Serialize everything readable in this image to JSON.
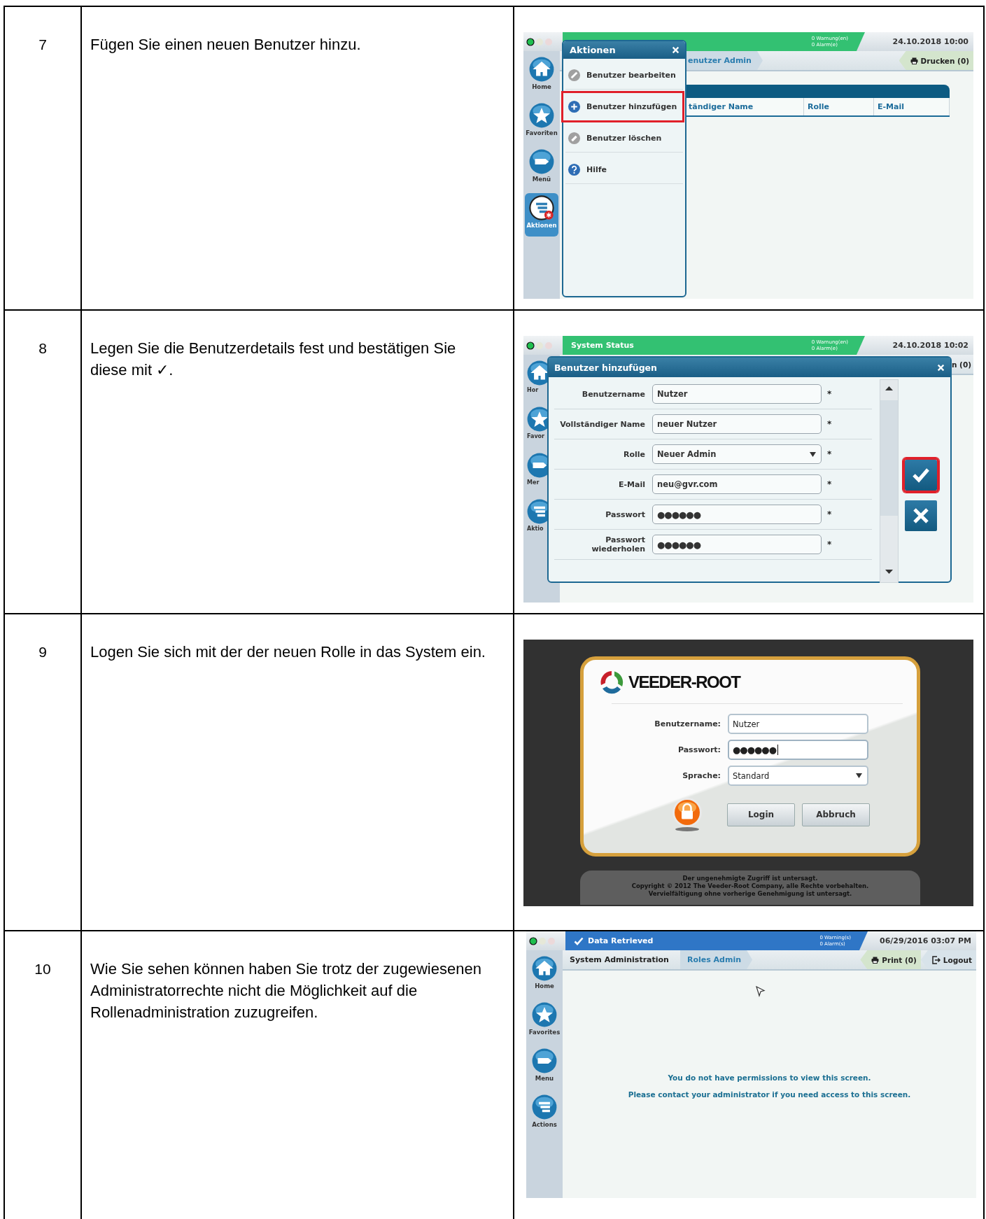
{
  "steps": [
    {
      "number": "7",
      "instruction": "Fügen Sie einen neuen Benutzer hinzu.",
      "screenshot": {
        "kind": "app",
        "status_bar": {
          "color": "#33c172",
          "warnings": "0 Warnung(en)",
          "alarms": "0 Alarm(e)",
          "datetime": "24.10.2018 10:00"
        },
        "breadcrumbs": [
          {
            "label": "enutzer Admin",
            "selected": true
          }
        ],
        "tools": [
          {
            "kind": "print",
            "label": "Drucken (0)"
          }
        ],
        "sidebar": [
          {
            "kind": "home",
            "label": "Home",
            "selected": false
          },
          {
            "kind": "favorites",
            "label": "Favoriten",
            "selected": false
          },
          {
            "kind": "menu",
            "label": "Menü",
            "selected": false
          },
          {
            "kind": "actions",
            "label": "Aktionen",
            "selected": true
          }
        ],
        "table_columns": [
          "tändiger Name",
          "Rolle",
          "E-Mail"
        ],
        "menu": {
          "title": "Aktionen",
          "items": [
            {
              "kind": "edit",
              "label": "Benutzer bearbeiten",
              "highlighted": false
            },
            {
              "kind": "add",
              "label": "Benutzer hinzufügen",
              "highlighted": true
            },
            {
              "kind": "delete",
              "label": "Benutzer löschen",
              "highlighted": false
            },
            {
              "kind": "help",
              "label": "Hilfe",
              "highlighted": false
            }
          ]
        }
      }
    },
    {
      "number": "8",
      "instruction": "Legen Sie die Benutzerdetails fest und bestätigen Sie diese mit ✓.",
      "screenshot": {
        "kind": "app",
        "status_bar": {
          "title": "System Status",
          "color": "#33c172",
          "warnings": "0 Warnung(en)",
          "alarms": "0 Alarm(e)",
          "datetime": "24.10.2018 10:02"
        },
        "tools": [
          {
            "kind": "text",
            "label": "n (0)"
          }
        ],
        "sidebar": [
          {
            "kind": "home",
            "label": "Hor",
            "selected": false
          },
          {
            "kind": "favorites",
            "label": "Favor",
            "selected": false
          },
          {
            "kind": "menu",
            "label": "Mer",
            "selected": false
          },
          {
            "kind": "actions",
            "label": "Aktio",
            "selected": false
          }
        ],
        "dialog": {
          "title": "Benutzer hinzufügen",
          "fields": [
            {
              "label": "Benutzername",
              "value": "Nutzer",
              "kind": "text",
              "mark": "*"
            },
            {
              "label": "Vollständiger Name",
              "value": "neuer Nutzer",
              "kind": "text",
              "mark": "*"
            },
            {
              "label": "Rolle",
              "value": "Neuer Admin",
              "kind": "select",
              "mark": "*"
            },
            {
              "label": "E-Mail",
              "value": "neu@gvr.com",
              "kind": "text",
              "mark": "*"
            },
            {
              "label": "Passwort",
              "value": "●●●●●●",
              "kind": "password",
              "mark": "*"
            },
            {
              "label": "Passwort wiederholen",
              "value": "●●●●●●",
              "kind": "password",
              "mark": "*"
            }
          ],
          "actions": [
            {
              "kind": "confirm",
              "highlighted": true
            },
            {
              "kind": "cancel",
              "highlighted": false
            }
          ]
        }
      }
    },
    {
      "number": "9",
      "instruction": "Logen Sie sich mit der der neuen Rolle in das System ein.",
      "screenshot": {
        "kind": "login",
        "logo": "VEEDER-ROOT",
        "fields": [
          {
            "label": "Benutzername:",
            "value": "Nutzer",
            "kind": "text",
            "focused": false
          },
          {
            "label": "Passwort:",
            "value": "●●●●●●",
            "kind": "password",
            "focused": true
          },
          {
            "label": "Sprache:",
            "value": "Standard",
            "kind": "select",
            "focused": false
          }
        ],
        "buttons": [
          "Login",
          "Abbruch"
        ],
        "notice": [
          "Der ungenehmigte Zugriff ist untersagt.",
          "Copyright © 2012 The Veeder-Root Company, alle Rechte vorbehalten.",
          "Vervielfältigung ohne vorherige Genehmigung ist untersagt."
        ]
      }
    },
    {
      "number": "10",
      "instruction": "Wie Sie sehen können haben Sie trotz der zugewiesenen Administratorrechte nicht die Möglichkeit auf die Rollenadministration zuzugreifen.",
      "screenshot": {
        "kind": "app",
        "status_bar": {
          "title": "Data Retrieved",
          "kind": "retrieved",
          "color": "#2f76c6",
          "warnings": "0 Warning(s)",
          "alarms": "0 Alarm(s)",
          "datetime": "06/29/2016 03:07 PM"
        },
        "breadcrumbs": [
          {
            "label": "System Administration",
            "selected": false
          },
          {
            "label": "Roles Admin",
            "selected": true
          }
        ],
        "tools": [
          {
            "kind": "print",
            "label": "Print (0)"
          },
          {
            "kind": "logout",
            "label": "Logout"
          }
        ],
        "sidebar": [
          {
            "kind": "home",
            "label": "Home",
            "selected": false
          },
          {
            "kind": "favorites",
            "label": "Favorites",
            "selected": false
          },
          {
            "kind": "menu",
            "label": "Menu",
            "selected": false
          },
          {
            "kind": "actions",
            "label": "Actions",
            "selected": false
          }
        ],
        "cursor": true,
        "message": [
          "You do not have permissions to view this screen.",
          "Please contact your administrator if you need access to this screen."
        ]
      }
    }
  ]
}
